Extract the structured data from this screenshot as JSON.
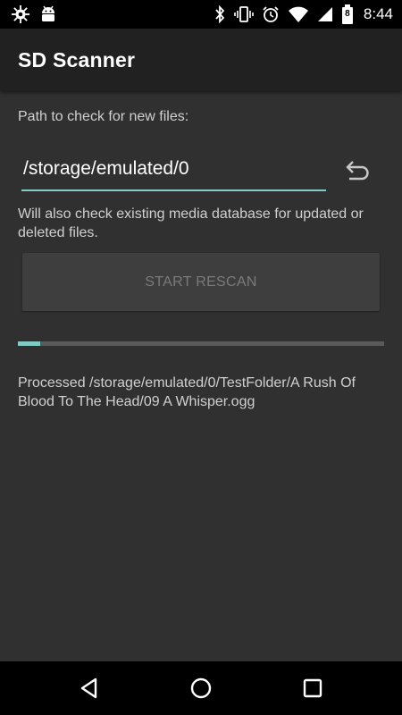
{
  "status_bar": {
    "time": "8:44",
    "battery_level": "8",
    "left_icons": [
      "settings-gear-icon",
      "android-icon"
    ],
    "right_icons": [
      "bluetooth-icon",
      "vibrate-icon",
      "alarm-icon",
      "wifi-icon",
      "signal-icon",
      "battery-icon"
    ]
  },
  "app_bar": {
    "title": "SD Scanner"
  },
  "form": {
    "path_label": "Path to check for new files:",
    "path_value": "/storage/emulated/0",
    "info_text": "Will also check existing media database for updated or deleted files.",
    "rescan_label": "START RESCAN",
    "undo_icon": "undo-icon"
  },
  "progress": {
    "fraction": 0.06,
    "fill_color": "#80cbc4"
  },
  "status": {
    "processed_text": "Processed /storage/emulated/0/TestFolder/A Rush Of Blood To The Head/09 A Whisper.ogg"
  },
  "nav_bar": {
    "icons": [
      "back-icon",
      "home-icon",
      "recents-icon"
    ]
  },
  "colors": {
    "accent": "#80cbc4",
    "background": "#303030",
    "app_bar": "#212121"
  }
}
